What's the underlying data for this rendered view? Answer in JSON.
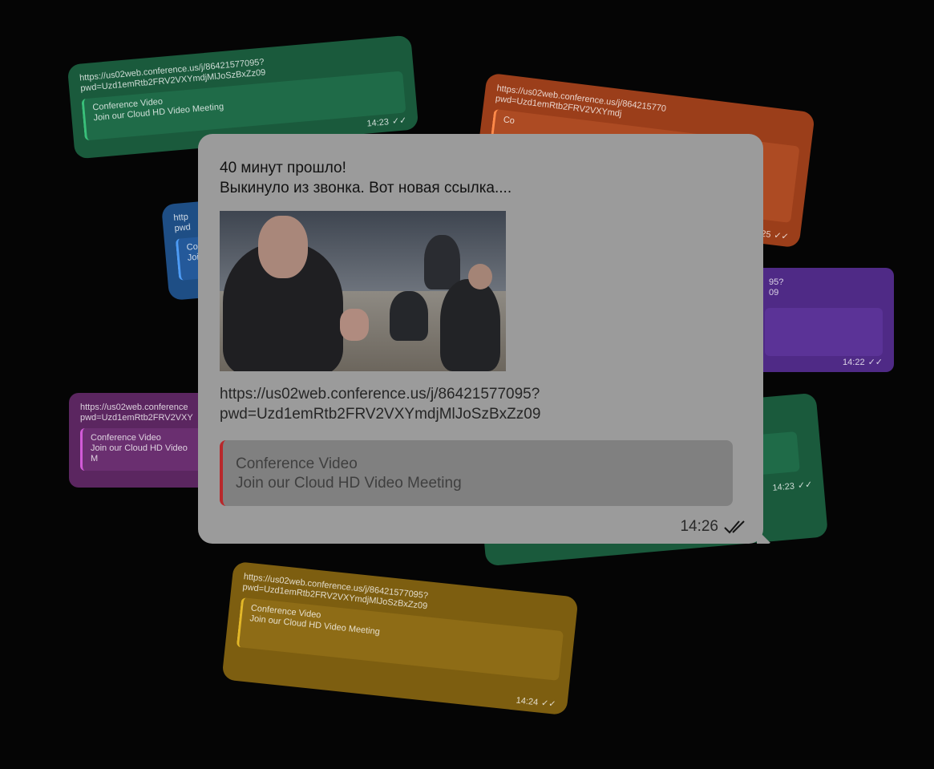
{
  "background_bubbles": [
    {
      "id": "green-top-left",
      "link": "https://us02web.conference.us/j/86421577095?\npwd=Uzd1emRtb2FRV2VXYmdjMlJoSzBxZz09",
      "preview_title": "Conference Video",
      "preview_desc": "Join our Cloud HD Video Meeting",
      "time": "14:23"
    },
    {
      "id": "orange-top-right",
      "link": "https://us02web.conference.us/j/864215770\npwd=Uzd1emRtb2FRV2VXYmdj",
      "preview_title": "Co",
      "preview_desc": "",
      "time": "14:25"
    },
    {
      "id": "blue-left",
      "link": "http\npwd",
      "preview_title": "Co",
      "preview_desc": "Join",
      "time": ""
    },
    {
      "id": "purple-right",
      "link": "95?\n09",
      "preview_title": "",
      "preview_desc": "",
      "time": "14:22"
    },
    {
      "id": "magenta-left",
      "link": "https://us02web.conference\npwd=Uzd1emRtb2FRV2VXY",
      "preview_title": "Conference Video",
      "preview_desc": "Join our Cloud HD Video M",
      "time": ""
    },
    {
      "id": "green-right",
      "link": "",
      "preview_title": "",
      "preview_desc": "",
      "time": "14:23"
    },
    {
      "id": "gold-bottom",
      "link": "https://us02web.conference.us/j/86421577095?\npwd=Uzd1emRtb2FRV2VXYmdjMlJoSzBxZz09",
      "preview_title": "Conference Video",
      "preview_desc": "Join our Cloud HD Video Meeting",
      "time": "14:24"
    }
  ],
  "main_message": {
    "line1": "40 минут прошло!",
    "line2": "Выкинуло из звонка. Вот новая ссылка....",
    "link_line1": "https://us02web.conference.us/j/86421577095?",
    "link_line2": "pwd=Uzd1emRtb2FRV2VXYmdjMlJoSzBxZz09",
    "preview_title": "Conference Video",
    "preview_desc": "Join our Cloud HD Video Meeting",
    "time": "14:26",
    "status_icon": "double-check-icon"
  },
  "colors": {
    "main_bubble": "#9b9b9b",
    "preview_accent": "#b8282b",
    "background": "#050505"
  }
}
